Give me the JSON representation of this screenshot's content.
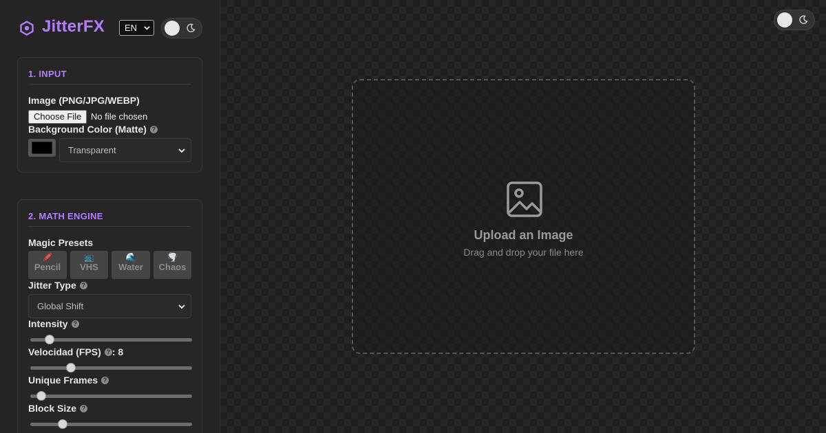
{
  "app": {
    "name": "JitterFX",
    "accent_color": "#b47cff"
  },
  "header": {
    "language": {
      "selected": "EN"
    },
    "theme_toggle": {
      "icon": "moon-icon",
      "state": "light-knob"
    }
  },
  "input_section": {
    "title": "1. INPUT",
    "image_label": "Image (PNG/JPG/WEBP)",
    "choose_file_label": "Choose File",
    "file_status": "No file chosen",
    "bg_color_label": "Background Color (Matte)",
    "bg_color_value": "#000000",
    "bg_select_value": "Transparent"
  },
  "math_section": {
    "title": "2. MATH ENGINE",
    "presets_label": "Magic Presets",
    "presets": [
      {
        "emoji": "🖍️",
        "label": "Pencil"
      },
      {
        "emoji": "📺",
        "label": "VHS"
      },
      {
        "emoji": "🌊",
        "label": "Water"
      },
      {
        "emoji": "🌪️",
        "label": "Chaos"
      }
    ],
    "jitter_type_label": "Jitter Type",
    "jitter_type_value": "Global Shift",
    "intensity_label": "Intensity",
    "intensity_level": 0.12,
    "fps_label": "Velocidad (FPS)",
    "fps_value": ": 8",
    "fps_level": 0.25,
    "unique_frames_label": "Unique Frames",
    "unique_frames_level": 0.07,
    "block_size_label": "Block Size",
    "block_size_level": 0.2
  },
  "canvas": {
    "upload_title": "Upload an Image",
    "upload_subtitle": "Drag and drop your file here",
    "icon": "image-icon"
  }
}
